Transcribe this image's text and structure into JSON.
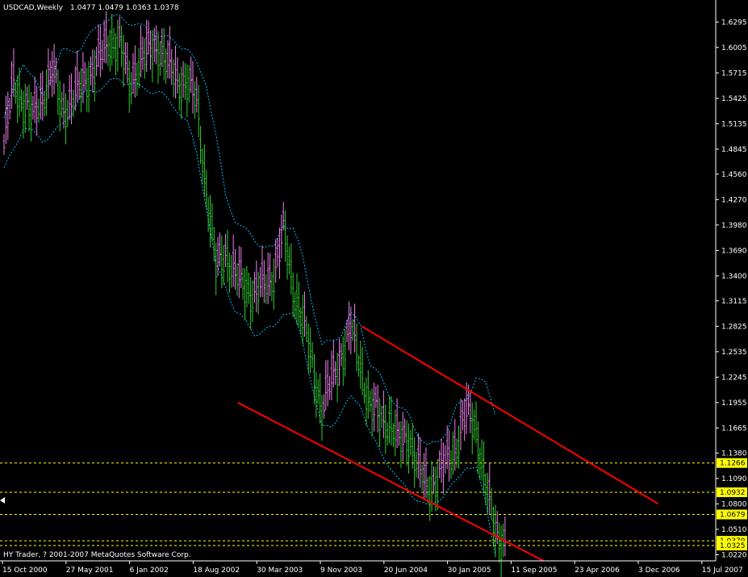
{
  "header": {
    "symbol": "USDCAD,Weekly",
    "ohlc": "1.0477 1.0479 1.0363 1.0378"
  },
  "footer": {
    "copyright": "HY Trader, ? 2001-2007 MetaQuotes Software Corp."
  },
  "colors": {
    "background": "#000000",
    "axis": "#ffffff",
    "bull_bar": "#ee82ee",
    "bear_bar": "#32cd32",
    "envelope": "#00bfff",
    "channel": "#ff0000",
    "level_line": "#ffff00",
    "price_tag_bg": "#ffff00"
  },
  "chart_data": {
    "type": "line",
    "title": "USDCAD,Weekly",
    "ohlc_last": {
      "open": 1.0477,
      "high": 1.0479,
      "low": 1.0363,
      "close": 1.0378
    },
    "ylim": [
      1.015,
      1.65
    ],
    "y_ticks": [
      "1.6295",
      "1.6005",
      "1.5715",
      "1.5425",
      "1.5135",
      "1.4845",
      "1.4560",
      "1.4270",
      "1.3980",
      "1.3690",
      "1.3400",
      "1.3115",
      "1.2825",
      "1.2535",
      "1.2245",
      "1.1955",
      "1.1665",
      "1.1380",
      "1.1090",
      "1.0800",
      "1.0510",
      "1.0220"
    ],
    "x_ticks": [
      "15 Oct 2000",
      "27 May 2001",
      "6 Jan 2002",
      "18 Aug 2002",
      "30 Mar 2003",
      "9 Nov 2003",
      "20 Jun 2004",
      "30 Jan 2005",
      "11 Sep 2005",
      "23 Apr 2006",
      "3 Dec 2006",
      "15 Jul 2007"
    ],
    "price_series": {
      "name": "",
      "anchors": [
        [
          0,
          1.49
        ],
        [
          1,
          1.56
        ],
        [
          3,
          1.52
        ],
        [
          5,
          1.575
        ],
        [
          6,
          1.53
        ],
        [
          8,
          1.555
        ],
        [
          10,
          1.59
        ],
        [
          11,
          1.61
        ],
        [
          12,
          1.605
        ],
        [
          13,
          1.56
        ],
        [
          14,
          1.585
        ],
        [
          16,
          1.605
        ],
        [
          17,
          1.58
        ],
        [
          18,
          1.565
        ],
        [
          19,
          1.56
        ],
        [
          20,
          1.54
        ],
        [
          21,
          1.44
        ],
        [
          22,
          1.35
        ],
        [
          23,
          1.37
        ],
        [
          24,
          1.34
        ],
        [
          26,
          1.32
        ],
        [
          27,
          1.33
        ],
        [
          28,
          1.345
        ],
        [
          29,
          1.39
        ],
        [
          30,
          1.33
        ],
        [
          31,
          1.29
        ],
        [
          32,
          1.24
        ],
        [
          33,
          1.19
        ],
        [
          34,
          1.22
        ],
        [
          35,
          1.25
        ],
        [
          36,
          1.28
        ],
        [
          37,
          1.24
        ],
        [
          38,
          1.19
        ],
        [
          39,
          1.18
        ],
        [
          40,
          1.175
        ],
        [
          41,
          1.15
        ],
        [
          42,
          1.16
        ],
        [
          43,
          1.12
        ],
        [
          44,
          1.1
        ],
        [
          45,
          1.11
        ],
        [
          46,
          1.13
        ],
        [
          47,
          1.15
        ],
        [
          48,
          1.185
        ],
        [
          49,
          1.17
        ],
        [
          50,
          1.1
        ],
        [
          51,
          1.05
        ],
        [
          52,
          1.038
        ]
      ]
    },
    "envelope_series": [
      {
        "name": "",
        "anchors": [
          [
            0,
            1.52
          ],
          [
            2,
            1.585
          ],
          [
            4,
            1.545
          ],
          [
            6,
            1.595
          ],
          [
            8,
            1.6
          ],
          [
            10,
            1.63
          ],
          [
            12,
            1.635
          ],
          [
            14,
            1.625
          ],
          [
            16,
            1.615
          ],
          [
            18,
            1.605
          ],
          [
            19,
            1.6
          ],
          [
            20,
            1.58
          ],
          [
            21,
            1.56
          ],
          [
            22,
            1.5
          ],
          [
            23,
            1.43
          ],
          [
            24,
            1.405
          ],
          [
            26,
            1.38
          ],
          [
            28,
            1.37
          ],
          [
            29,
            1.4
          ],
          [
            30,
            1.395
          ],
          [
            31,
            1.36
          ],
          [
            32,
            1.31
          ],
          [
            33,
            1.26
          ],
          [
            34,
            1.265
          ],
          [
            35,
            1.275
          ],
          [
            36,
            1.295
          ],
          [
            37,
            1.285
          ],
          [
            38,
            1.24
          ],
          [
            39,
            1.225
          ],
          [
            40,
            1.205
          ],
          [
            41,
            1.19
          ],
          [
            42,
            1.18
          ],
          [
            43,
            1.16
          ],
          [
            44,
            1.145
          ],
          [
            45,
            1.15
          ],
          [
            46,
            1.165
          ],
          [
            47,
            1.19
          ],
          [
            48,
            1.2
          ],
          [
            49,
            1.225
          ],
          [
            50,
            1.215
          ],
          [
            51,
            1.185
          ]
        ]
      },
      {
        "name": "",
        "anchors": [
          [
            0,
            1.46
          ],
          [
            2,
            1.51
          ],
          [
            4,
            1.495
          ],
          [
            6,
            1.51
          ],
          [
            8,
            1.545
          ],
          [
            10,
            1.555
          ],
          [
            12,
            1.565
          ],
          [
            14,
            1.555
          ],
          [
            16,
            1.55
          ],
          [
            18,
            1.53
          ],
          [
            19,
            1.515
          ],
          [
            20,
            1.48
          ],
          [
            21,
            1.42
          ],
          [
            22,
            1.35
          ],
          [
            23,
            1.33
          ],
          [
            24,
            1.3
          ],
          [
            26,
            1.275
          ],
          [
            28,
            1.28
          ],
          [
            29,
            1.3
          ],
          [
            30,
            1.295
          ],
          [
            31,
            1.265
          ],
          [
            32,
            1.215
          ],
          [
            33,
            1.165
          ],
          [
            34,
            1.17
          ],
          [
            35,
            1.185
          ],
          [
            36,
            1.2
          ],
          [
            37,
            1.195
          ],
          [
            38,
            1.16
          ],
          [
            39,
            1.14
          ],
          [
            40,
            1.125
          ],
          [
            41,
            1.105
          ],
          [
            42,
            1.095
          ],
          [
            43,
            1.085
          ],
          [
            44,
            1.075
          ],
          [
            45,
            1.085
          ],
          [
            46,
            1.095
          ],
          [
            47,
            1.105
          ],
          [
            48,
            1.125
          ],
          [
            49,
            1.12
          ],
          [
            50,
            1.08
          ],
          [
            51,
            1.025
          ]
        ]
      }
    ],
    "channel_lines": [
      {
        "x": [
          37.14,
          67.9
        ],
        "y": [
          1.2825,
          1.08
        ]
      },
      {
        "x": [
          24.26,
          56.0
        ],
        "y": [
          1.1955,
          1.015
        ]
      }
    ],
    "horizontal_levels": [
      {
        "value": 1.1266,
        "label": "1.1266"
      },
      {
        "value": 1.0932,
        "label": "1.0932"
      },
      {
        "value": 1.0679,
        "label": "1.0679"
      },
      {
        "value": 1.0379,
        "label": "1.0379"
      },
      {
        "value": 1.0325,
        "label": "1.0325"
      }
    ]
  }
}
